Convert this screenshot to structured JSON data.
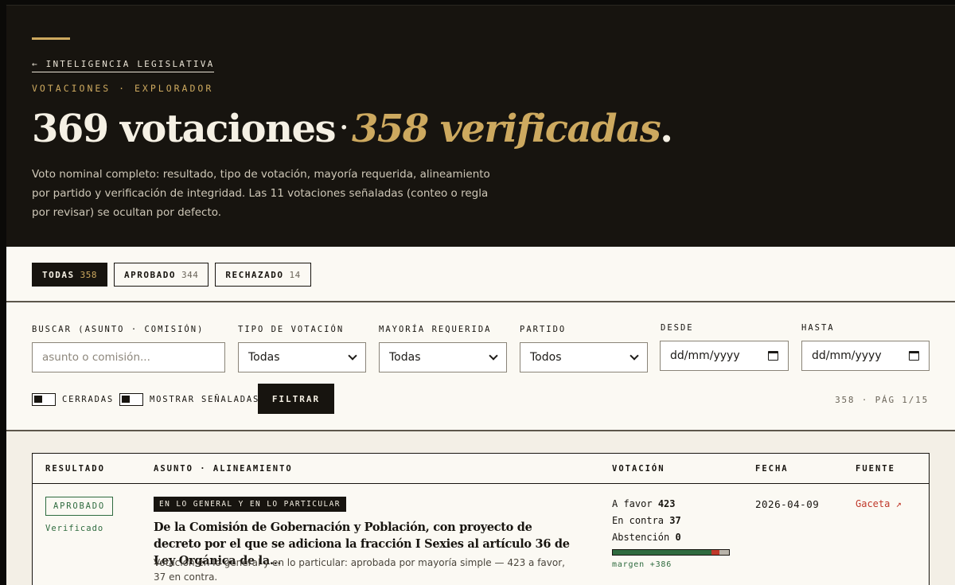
{
  "header": {
    "back_link": "← INTELIGENCIA LEGISLATIVA",
    "kicker": "VOTACIONES · EXPLORADOR",
    "title_count": "369 votaciones",
    "title_sep": "·",
    "title_verified": "358 verificadas",
    "title_end": ".",
    "description": "Voto nominal completo: resultado, tipo de votación, mayoría requerida, alineamiento por partido y verificación de integridad. Las 11 votaciones señaladas (conteo o regla por revisar) se ocultan por defecto."
  },
  "tabs": [
    {
      "label": "TODAS",
      "count": "358",
      "active": true
    },
    {
      "label": "APROBADO",
      "count": "344",
      "active": false
    },
    {
      "label": "RECHAZADO",
      "count": "14",
      "active": false
    }
  ],
  "filters": {
    "search_label": "BUSCAR (ASUNTO · COMISIÓN)",
    "search_placeholder": "asunto o comisión...",
    "vote_type_label": "TIPO DE VOTACIÓN",
    "vote_type_value": "Todas",
    "majority_label": "MAYORÍA REQUERIDA",
    "majority_value": "Todas",
    "party_label": "PARTIDO",
    "party_value": "Todos",
    "from_label": "DESDE",
    "from_value": "dd/mm/yyyy",
    "to_label": "HASTA",
    "to_value": "dd/mm/yyyy",
    "closed_toggle": "CERRADAS",
    "flagged_toggle": "MOSTRAR SEÑALADAS",
    "filter_button": "FILTRAR",
    "page_info": "358 · PÁG 1/15"
  },
  "table": {
    "columns": [
      "RESULTADO",
      "ASUNTO · ALINEAMIENTO",
      "VOTACIÓN",
      "FECHA",
      "FUENTE"
    ],
    "rows": [
      {
        "result": "APROBADO",
        "verified": "Verificado",
        "vote_type": "EN LO GENERAL Y EN LO PARTICULAR",
        "subject": "De la Comisión de Gobernación y Población, con proyecto de decreto por el que se adiciona la fracción I Sexies al artículo 36 de Ley Orgánica de la...",
        "summary": "Votación en lo general y en lo particular: aprobada por mayoría simple — 423 a favor, 37 en contra.",
        "favor_label": "A favor",
        "favor": 423,
        "contra_label": "En contra",
        "contra": 37,
        "abst_label": "Abstención",
        "abst": 0,
        "margin": "margen +386",
        "date": "2026-04-09",
        "source": "Gaceta ↗"
      }
    ]
  },
  "colors": {
    "dark": "#17140f",
    "gold": "#cda95f",
    "green": "#2f6b3f",
    "red": "#c0392b"
  }
}
